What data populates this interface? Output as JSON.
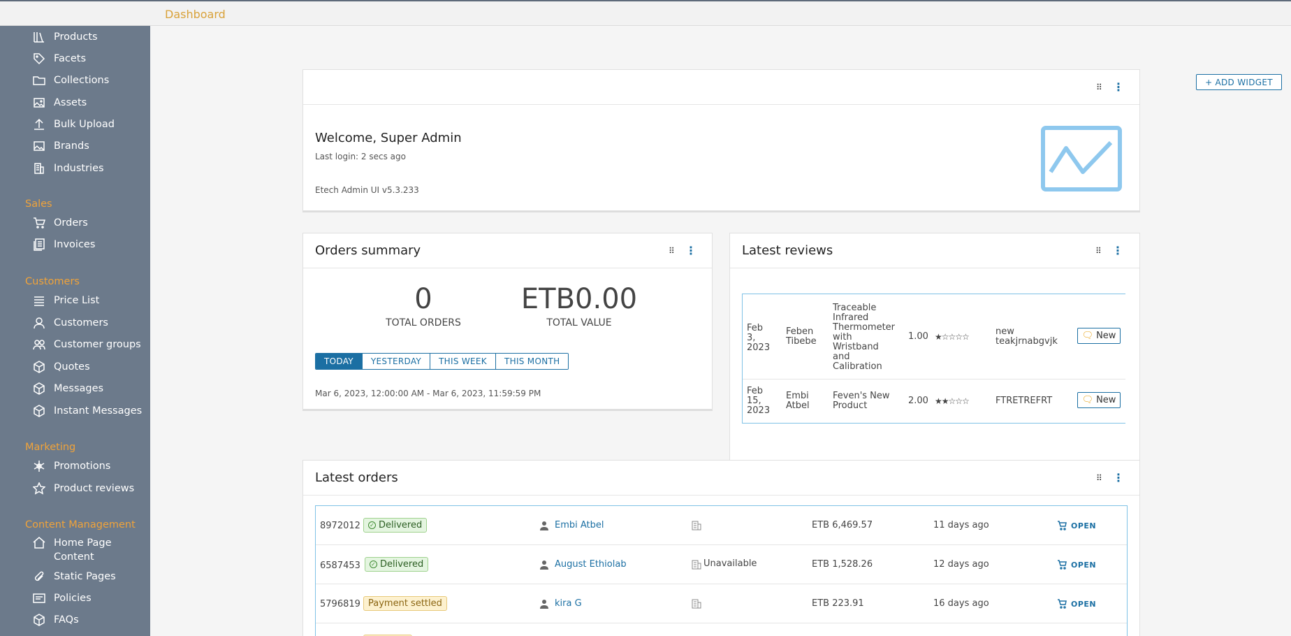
{
  "header": {
    "breadcrumb": "Dashboard"
  },
  "sidebar": {
    "catalog_items": [
      {
        "label": "Products",
        "icon": "library-icon"
      },
      {
        "label": "Facets",
        "icon": "tag-icon"
      },
      {
        "label": "Collections",
        "icon": "folder-icon"
      },
      {
        "label": "Assets",
        "icon": "image-icon"
      },
      {
        "label": "Bulk Upload",
        "icon": "upload-icon"
      },
      {
        "label": "Brands",
        "icon": "image-icon"
      },
      {
        "label": "Industries",
        "icon": "building-icon"
      }
    ],
    "sales": {
      "title": "Sales",
      "items": [
        {
          "label": "Orders",
          "icon": "cart-icon"
        },
        {
          "label": "Invoices",
          "icon": "invoice-icon"
        }
      ]
    },
    "customers": {
      "title": "Customers",
      "items": [
        {
          "label": "Price List",
          "icon": "list-icon"
        },
        {
          "label": "Customers",
          "icon": "user-icon"
        },
        {
          "label": "Customer groups",
          "icon": "users-icon"
        },
        {
          "label": "Quotes",
          "icon": "box-icon"
        },
        {
          "label": "Messages",
          "icon": "box-icon"
        },
        {
          "label": "Instant Messages",
          "icon": "box-icon"
        }
      ]
    },
    "marketing": {
      "title": "Marketing",
      "items": [
        {
          "label": "Promotions",
          "icon": "asterisk-icon"
        },
        {
          "label": "Product reviews",
          "icon": "star-icon"
        }
      ]
    },
    "content": {
      "title": "Content Management",
      "items": [
        {
          "label": "Home Page Content",
          "icon": "home-icon"
        },
        {
          "label": "Static Pages",
          "icon": "paperclip-icon"
        },
        {
          "label": "Policies",
          "icon": "card-icon"
        },
        {
          "label": "FAQs",
          "icon": "box-icon"
        }
      ]
    }
  },
  "toolbar": {
    "add_widget_label": "ADD WIDGET"
  },
  "welcome": {
    "title": "Welcome, Super Admin",
    "last_login": "Last login: 2 secs ago",
    "version": "Etech Admin UI v5.3.233",
    "logo_color": "#8ec8ee"
  },
  "orders_summary": {
    "title": "Orders summary",
    "total_orders": "0",
    "total_orders_label": "TOTAL ORDERS",
    "total_value": "ETB0.00",
    "total_value_label": "TOTAL VALUE",
    "ranges": [
      "TODAY",
      "YESTERDAY",
      "THIS WEEK",
      "THIS MONTH"
    ],
    "active_range": "TODAY",
    "date_range": "Mar 6, 2023, 12:00:00 AM - Mar 6, 2023, 11:59:59 PM"
  },
  "latest_reviews": {
    "title": "Latest reviews",
    "rows": [
      {
        "date": "Feb 3, 2023",
        "author": "Feben Tibebe",
        "product": "Traceable Infrared Thermometer with Wristband and Calibration",
        "rating": "1.00",
        "stars": 1,
        "summary": "new teakjrnabgvjk",
        "status": "New"
      },
      {
        "date": "Feb 15, 2023",
        "author": "Embi Atbel",
        "product": "Feven's New Product",
        "rating": "2.00",
        "stars": 2,
        "summary": "FTRETREFRT",
        "status": "New"
      }
    ]
  },
  "latest_orders": {
    "title": "Latest orders",
    "open_label": "OPEN",
    "rows": [
      {
        "code": "8972012",
        "state": "Delivered",
        "state_kind": "ok",
        "customer": "Embi Atbel",
        "company": "",
        "total": "ETB 6,469.57",
        "age": "11 days ago"
      },
      {
        "code": "6587453",
        "state": "Delivered",
        "state_kind": "ok",
        "customer": "August Ethiolab",
        "company": "Unavailable",
        "total": "ETB 1,528.26",
        "age": "12 days ago"
      },
      {
        "code": "5796819",
        "state": "Payment settled",
        "state_kind": "warn",
        "customer": "kira G",
        "company": "",
        "total": "ETB 223.91",
        "age": "16 days ago"
      }
    ]
  },
  "colors": {
    "accent": "#1b6fa3",
    "sidebar": "#6c7a8b",
    "section": "#f0a33a",
    "breadcrumb": "#d9a23a"
  }
}
